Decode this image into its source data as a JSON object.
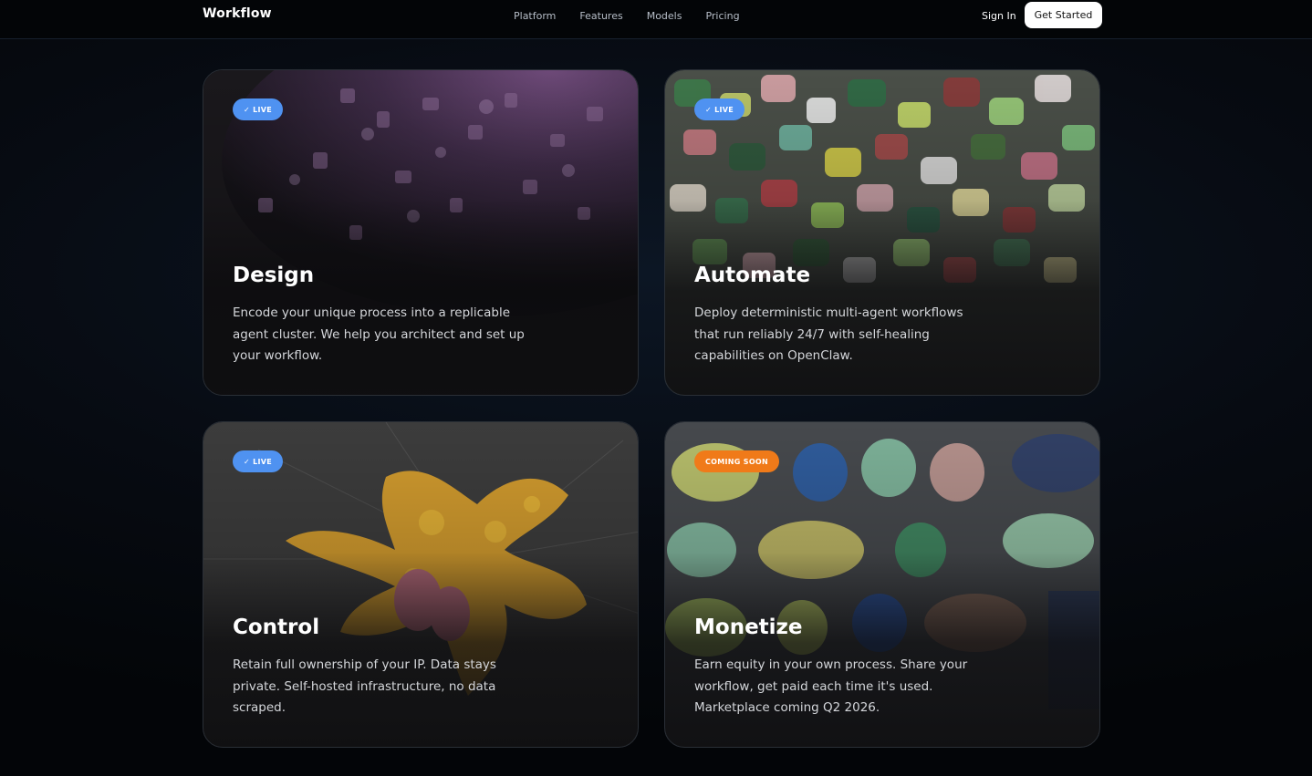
{
  "nav": {
    "brand": "Workflow",
    "links": [
      "Platform",
      "Features",
      "Models",
      "Pricing"
    ],
    "sign_in": "Sign In",
    "get_started": "Get Started"
  },
  "cards": [
    {
      "badge": "✓ LIVE",
      "title": "Design",
      "description": "Encode your unique process into a replicable agent cluster. We help you architect and set up your workflow."
    },
    {
      "badge": "✓ LIVE",
      "title": "Automate",
      "description": "Deploy deterministic multi-agent workflows that run reliably 24/7 with self-healing capabilities on OpenClaw."
    },
    {
      "badge": "✓ LIVE",
      "title": "Control",
      "description": "Retain full ownership of your IP. Data stays private. Self-hosted infrastructure, no data scraped."
    },
    {
      "badge": "COMING SOON",
      "title": "Monetize",
      "description": "Earn equity in your own process. Share your workflow, get paid each time it's used. Marketplace coming Q2 2026."
    }
  ],
  "colors": {
    "live_badge": "#4f92f1",
    "soon_badge": "#f07a19",
    "background": "#05080d"
  },
  "icons": {
    "check": "check-icon"
  }
}
